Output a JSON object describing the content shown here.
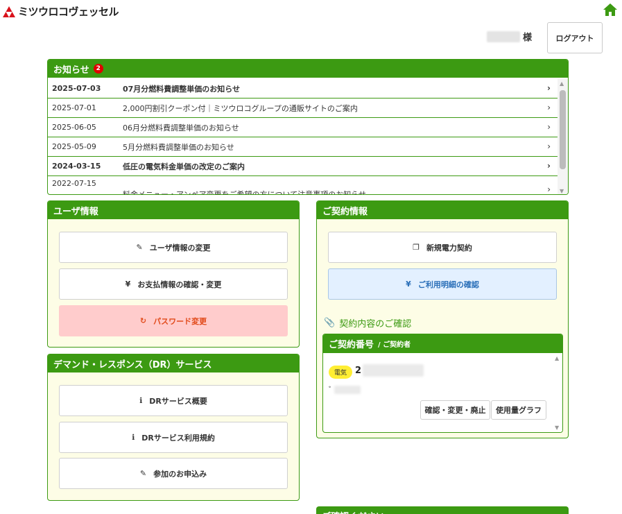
{
  "header": {
    "logo_text": "ミツウロコヴェッセル",
    "honorific": "様",
    "logout_label": "ログアウト"
  },
  "news": {
    "title": "お知らせ",
    "badge": "2",
    "items": [
      {
        "date": "2025-07-03",
        "title": "07月分燃料費調整単価のお知らせ",
        "bold": true
      },
      {
        "date": "2025-07-01",
        "title": "2,000円割引クーポン付｜ミツウロコグループの通販サイトのご案内",
        "bold": false
      },
      {
        "date": "2025-06-05",
        "title": "06月分燃料費調整単価のお知らせ",
        "bold": false
      },
      {
        "date": "2025-05-09",
        "title": "5月分燃料費調整単価のお知らせ",
        "bold": false
      },
      {
        "date": "2024-03-15",
        "title": "低圧の電気料金単価の改定のご案内",
        "bold": true
      },
      {
        "date": "2022-07-15",
        "title": "料金メニュー・アンペア変更をご希望の方について注意事項のお知らせ",
        "bold": false
      }
    ]
  },
  "user_info": {
    "title": "ユーザ情報",
    "buttons": [
      {
        "icon": "pencil-icon",
        "label": "ユーザ情報の変更"
      },
      {
        "icon": "yen-icon",
        "label": "お支払情報の確認・変更"
      },
      {
        "icon": "refresh-icon",
        "label": "パスワード変更"
      }
    ]
  },
  "dr": {
    "title": "デマンド・レスポンス（DR）サービス",
    "buttons": [
      {
        "icon": "info-icon",
        "label": "DRサービス概要"
      },
      {
        "icon": "info-icon",
        "label": "DRサービス利用規約"
      },
      {
        "icon": "pencil-icon",
        "label": "参加のお申込み"
      }
    ]
  },
  "contract": {
    "title": "ご契約情報",
    "new_contract_label": "新規電力契約",
    "usage_details_label": "ご利用明細の確認",
    "confirm_link": "契約内容のご確認",
    "sub_title": "ご契約番号",
    "sub_title_suffix": " / ご契約者",
    "type_badge": "電気",
    "number_prefix": "2",
    "contractor_prefix": "ﾞ",
    "action_modify": "確認・変更・廃止",
    "action_graph": "使用量グラフ"
  },
  "bottom": {
    "title": "ご確認ください"
  },
  "colors": {
    "brand_green": "#3c9a12",
    "panel_bg": "#fdfde6",
    "password_bg": "#ffcccc",
    "password_text": "#e24b1b",
    "usage_btn_bg": "#e3f0ff",
    "usage_btn_text": "#2a6fb8",
    "elec_badge": "#ffee33",
    "logo_red": "#d9121b"
  }
}
